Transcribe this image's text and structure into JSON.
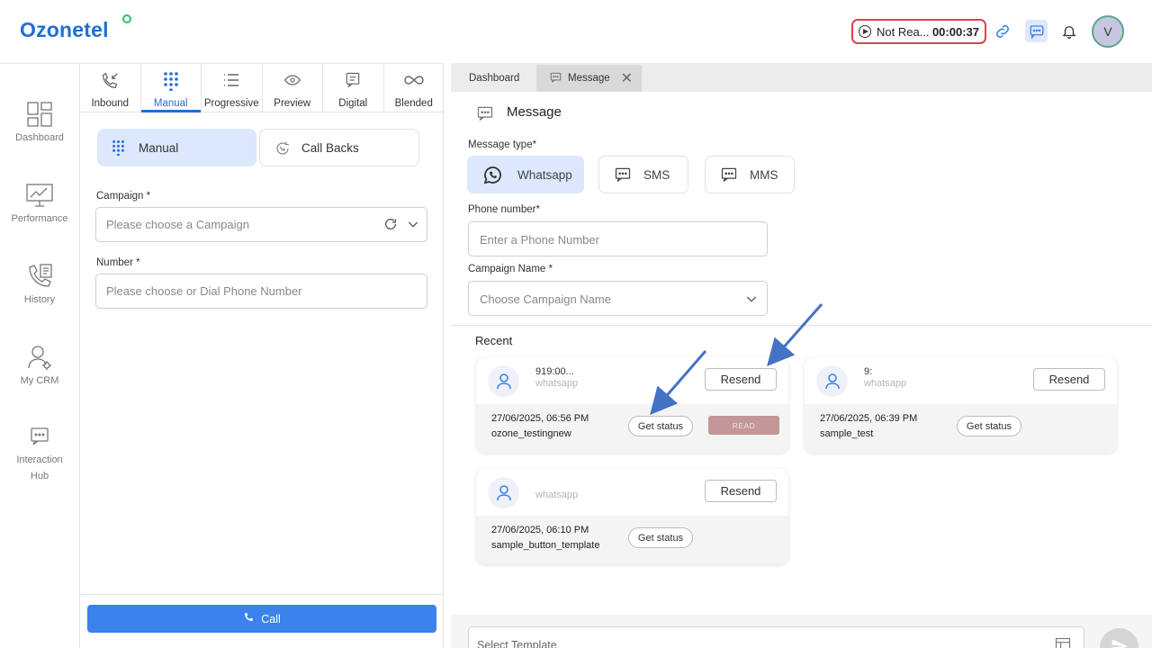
{
  "app": {
    "logo": "Ozonetel"
  },
  "header": {
    "status_text": "Not Rea...",
    "timer": "00:00:37",
    "avatar_initial": "V"
  },
  "left_nav": {
    "items": [
      {
        "label": "Dashboard",
        "icon": "dashboard-icon"
      },
      {
        "label": "Performance",
        "icon": "performance-icon"
      },
      {
        "label": "History",
        "icon": "history-icon"
      },
      {
        "label": "My CRM",
        "icon": "crm-icon"
      },
      {
        "label": "Interaction",
        "label2": "Hub",
        "icon": "interaction-hub-icon"
      }
    ]
  },
  "dialer": {
    "tabs": [
      {
        "label": "Inbound",
        "icon": "inbound-call-icon"
      },
      {
        "label": "Manual",
        "icon": "dialpad-icon"
      },
      {
        "label": "Progressive",
        "icon": "list-icon"
      },
      {
        "label": "Preview",
        "icon": "eye-icon"
      },
      {
        "label": "Digital",
        "icon": "chat-icon"
      },
      {
        "label": "Blended",
        "icon": "infinity-icon"
      }
    ],
    "active_tab": "Manual",
    "manual_label": "Manual",
    "callbacks_label": "Call Backs",
    "campaign_label": "Campaign *",
    "campaign_placeholder": "Please choose a Campaign",
    "number_label": "Number *",
    "number_placeholder": "Please choose or Dial Phone Number",
    "call_label": "Call"
  },
  "workspace": {
    "tabs": [
      {
        "label": "Dashboard"
      },
      {
        "label": "Message"
      }
    ],
    "title": "Message",
    "message_type_label": "Message type*",
    "types": [
      {
        "label": "Whatsapp",
        "selected": true
      },
      {
        "label": "SMS",
        "selected": false
      },
      {
        "label": "MMS",
        "selected": false
      }
    ],
    "phone_label": "Phone number*",
    "phone_placeholder": "Enter a Phone Number",
    "campaign_label": "Campaign Name *",
    "campaign_placeholder": "Choose Campaign Name",
    "recent_label": "Recent",
    "recent": [
      {
        "number": "919:00...",
        "channel": "whatsapp",
        "resend": "Resend",
        "datetime": "27/06/2025, 06:56 PM",
        "template": "ozone_testingnew",
        "get_status": "Get status",
        "status": "READ"
      },
      {
        "number": "9:",
        "channel": "whatsapp",
        "resend": "Resend",
        "datetime": "27/06/2025, 06:39 PM",
        "template": "sample_test",
        "get_status": "Get status",
        "status": ""
      },
      {
        "number": "",
        "channel": "whatsapp",
        "resend": "Resend",
        "datetime": "27/06/2025, 06:10 PM",
        "template": "sample_button_template",
        "get_status": "Get status",
        "status": ""
      }
    ],
    "template_placeholder": "Select Template"
  },
  "colors": {
    "accent": "#1f6fd6",
    "call_button": "#3b82ec",
    "status_border": "#d9434b",
    "read_badge": "#c39698",
    "annotation_arrow": "#4472c4"
  }
}
